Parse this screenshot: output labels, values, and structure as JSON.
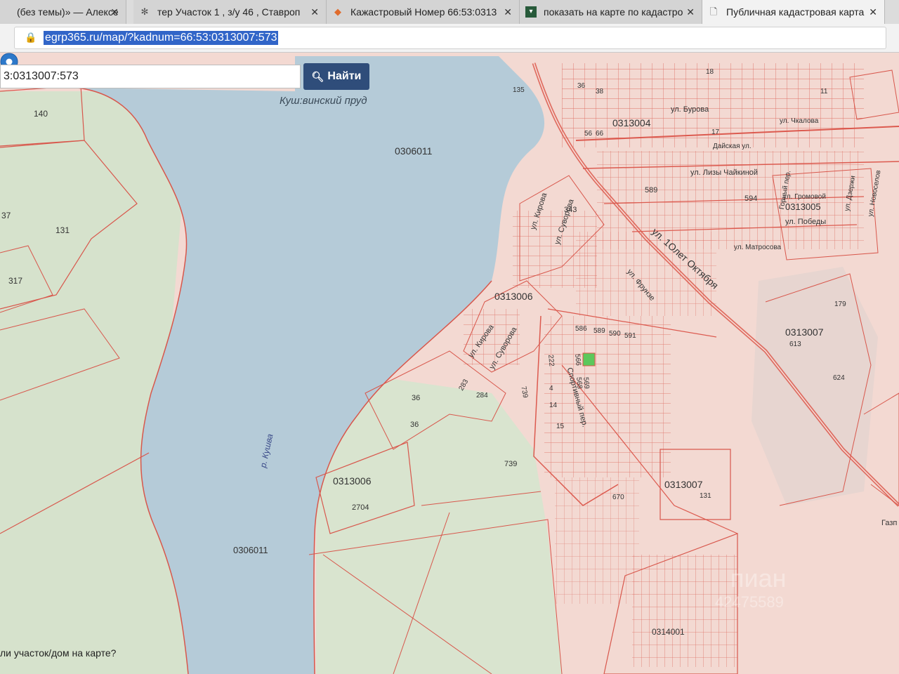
{
  "browser": {
    "tabs": [
      {
        "title": "(без темы)» — Алексе",
        "icon": "mail-icon"
      },
      {
        "title": "тер Участок 1 , з/у 46 , Ставроп",
        "icon": "bug-icon"
      },
      {
        "title": "Кажастровый Номер 66:53:0313",
        "icon": "map-icon"
      },
      {
        "title": "показать на карте по кадастро",
        "icon": "dark-square-icon"
      },
      {
        "title": "Публичная кадастровая карта",
        "icon": "document-icon"
      }
    ],
    "address": "egrp365.ru/map/?kadnum=66:53:0313007:573"
  },
  "search": {
    "value": "3:0313007:573",
    "button_label": "Найти",
    "button_icon": "search-icon"
  },
  "map": {
    "water_label": "Куш:винский пруд",
    "river_label": "р. Кушва",
    "quarter_labels": [
      "0306011",
      "0313004",
      "0313005",
      "0313006",
      "0313006",
      "0313007",
      "0313007",
      "0306011",
      "0314001"
    ],
    "street_labels": [
      "ул. Бурова",
      "Дайская ул.",
      "ул. Лизы Чайкиной",
      "ул. Громовой",
      "ул. Победы",
      "ул. Кирова",
      "ул. Суворова",
      "ул. Кирова",
      "ул. Суворова",
      "ул. Фрунзе",
      "ул. 1Олет Октября",
      "Спортивный пер.",
      "ул. Новоселов",
      "ул. Дзержи",
      "Горный пер.",
      "ул. Чкалова",
      "ул. Матросова"
    ],
    "parcel_numbers": [
      "140",
      "131",
      "37",
      "317",
      "135",
      "36",
      "38",
      "18",
      "17",
      "11",
      "56",
      "66",
      "589",
      "594",
      "343",
      "179",
      "613",
      "624",
      "586",
      "589",
      "590",
      "591",
      "566",
      "568",
      "569",
      "222",
      "4",
      "14",
      "15",
      "36",
      "36",
      "283",
      "284",
      "739",
      "739",
      "2704",
      "131",
      "670"
    ],
    "partial_labels": [
      "Газп",
      "пиан",
      "42475589"
    ],
    "marker_icon": "map-pin-icon",
    "selected_parcel": "0313007:573"
  },
  "footer_question": "ли участок/дом на карте?",
  "colors": {
    "water": "#b5cbd8",
    "land": "#f3d9d2",
    "forest": "#d6e2cc",
    "boundary": "#d8574c",
    "button": "#2f4d7a",
    "selected": "#5bc85b",
    "marker": "#2d78c9"
  }
}
